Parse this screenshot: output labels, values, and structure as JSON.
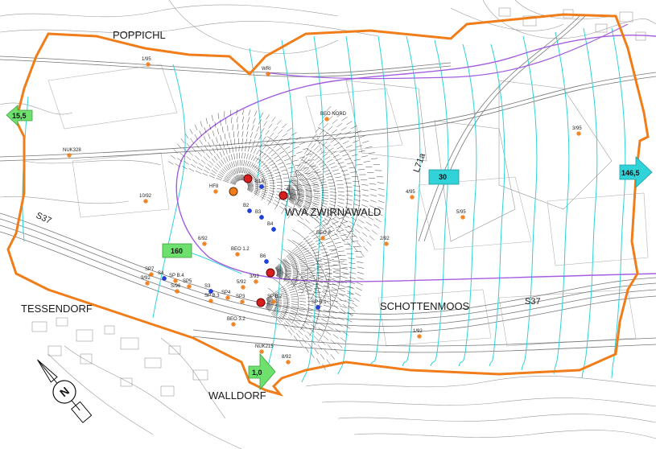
{
  "places": {
    "poppichl": "POPPICHL",
    "tessendorf": "TESSENDORF",
    "walddorf": "WALLDORF",
    "schottenmoos": "SCHOTTENMOOS",
    "wva": "WVA ZWIRNAWALD"
  },
  "roads": {
    "s37_west": "S37",
    "s37_east": "S37",
    "l71a": "L71a"
  },
  "head_values": {
    "west": "15,5",
    "east": "146,5",
    "south": "1,0",
    "box_160": "160",
    "box_30": "30"
  },
  "wells": [
    {
      "label": "1/95"
    },
    {
      "label": "WRI"
    },
    {
      "label": "BEO NORD"
    },
    {
      "label": "3/95"
    },
    {
      "label": "NUK328"
    },
    {
      "label": "10/92"
    },
    {
      "label": "4/95"
    },
    {
      "label": "5/95"
    },
    {
      "label": "2/92"
    },
    {
      "label": "6/92"
    },
    {
      "label": "BEO 8"
    },
    {
      "label": "BEO 1.2"
    },
    {
      "label": "SP7"
    },
    {
      "label": "9/92"
    },
    {
      "label": "SP5"
    },
    {
      "label": "S3"
    },
    {
      "label": "SP4"
    },
    {
      "label": "SP3"
    },
    {
      "label": "3/93"
    },
    {
      "label": "5/92"
    },
    {
      "label": "BEO 3.2"
    },
    {
      "label": "1/92"
    },
    {
      "label": "NUK215"
    },
    {
      "label": "8/92"
    },
    {
      "label": "B6"
    },
    {
      "label": "S4"
    },
    {
      "label": "SP B.4"
    },
    {
      "label": "S/96"
    },
    {
      "label": "SP B.3"
    },
    {
      "label": "SP B.2"
    },
    {
      "label": "SP B.1"
    },
    {
      "label": "B4"
    },
    {
      "label": "B3"
    },
    {
      "label": "B1A"
    },
    {
      "label": "B2"
    },
    {
      "label": "HF8"
    }
  ],
  "colors": {
    "boundary": "#f07d1a",
    "isolines": "#2fd3d8",
    "capture_zone": "#a35ee0",
    "arrow_green": "#6ee06e",
    "arrow_cyan": "#2fd3d8",
    "well_orange": "#f07d1a",
    "well_blue": "#1f3fd6",
    "pump_red": "#d62020"
  },
  "north_arrow": {
    "label": "N"
  }
}
